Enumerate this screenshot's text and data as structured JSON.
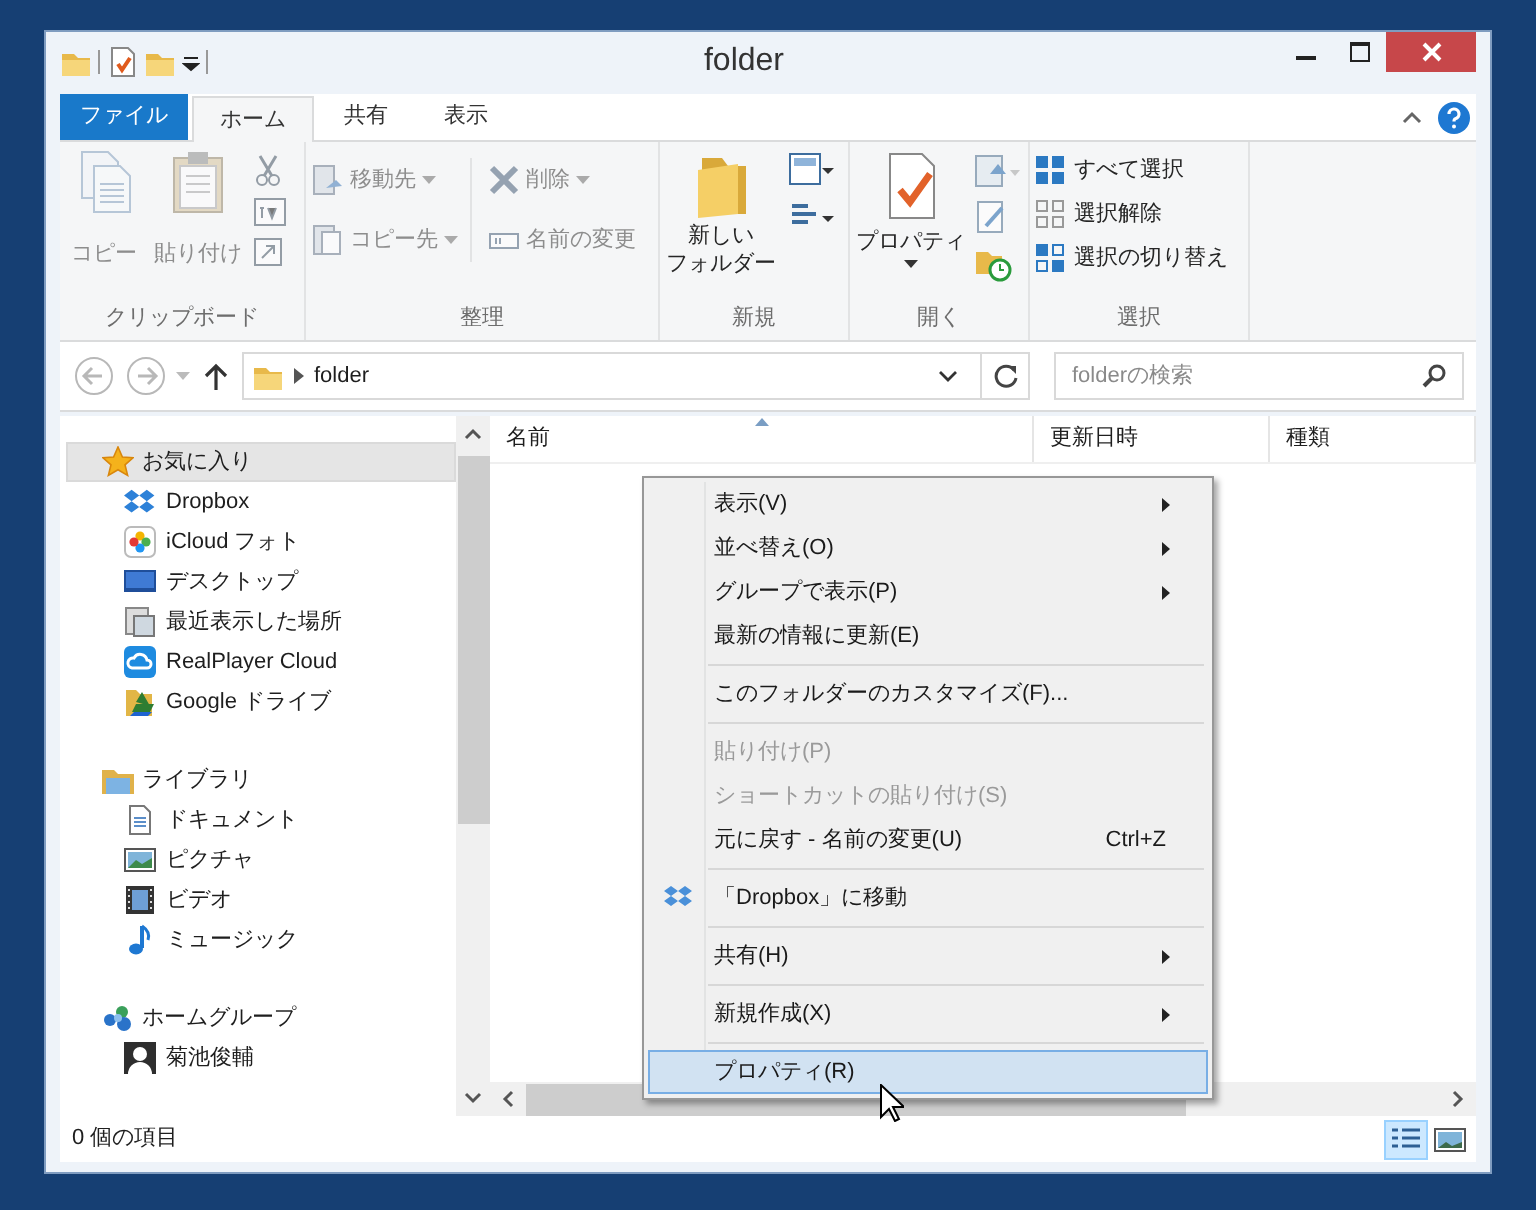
{
  "window": {
    "title": "folder"
  },
  "tabs": [
    {
      "label": "ファイル",
      "kind": "file",
      "selected": false
    },
    {
      "label": "ホーム",
      "kind": "tab",
      "selected": true
    },
    {
      "label": "共有",
      "kind": "tab",
      "selected": false
    },
    {
      "label": "表示",
      "kind": "tab",
      "selected": false
    }
  ],
  "ribbon": {
    "groups": [
      {
        "label": "クリップボード",
        "buttons": [
          {
            "label": "コピー",
            "disabled": true
          },
          {
            "label": "貼り付け",
            "disabled": true
          }
        ]
      },
      {
        "label": "整理",
        "buttons": [
          {
            "label": "移動先",
            "disabled": true,
            "dropdown": true
          },
          {
            "label": "コピー先",
            "disabled": true,
            "dropdown": true
          },
          {
            "label": "削除",
            "disabled": true,
            "dropdown": true
          },
          {
            "label": "名前の変更",
            "disabled": true,
            "dropdown": false
          }
        ]
      },
      {
        "label": "新規",
        "buttons": [
          {
            "label_lines": [
              "新しい",
              "フォルダー"
            ],
            "disabled": false
          }
        ]
      },
      {
        "label": "開く",
        "buttons": [
          {
            "label": "プロパティ",
            "disabled": false,
            "dropdown": true
          }
        ]
      },
      {
        "label": "選択",
        "buttons": [
          {
            "label": "すべて選択",
            "disabled": false
          },
          {
            "label": "選択解除",
            "disabled": false
          },
          {
            "label": "選択の切り替え",
            "disabled": false
          }
        ]
      }
    ]
  },
  "address": {
    "path": "folder",
    "search_placeholder": "folderの検索"
  },
  "navigation": [
    {
      "label": "お気に入り",
      "selected": true,
      "children": [
        {
          "label": "Dropbox"
        },
        {
          "label": "iCloud フォト"
        },
        {
          "label": "デスクトップ"
        },
        {
          "label": "最近表示した場所"
        },
        {
          "label": "RealPlayer Cloud"
        },
        {
          "label": "Google ドライブ"
        }
      ]
    },
    {
      "label": "ライブラリ",
      "selected": false,
      "children": [
        {
          "label": "ドキュメント"
        },
        {
          "label": "ピクチャ"
        },
        {
          "label": "ビデオ"
        },
        {
          "label": "ミュージック"
        }
      ]
    },
    {
      "label": "ホームグループ",
      "selected": false,
      "children": [
        {
          "label": "菊池俊輔"
        }
      ]
    }
  ],
  "columns": [
    {
      "label": "名前",
      "sorted": true
    },
    {
      "label": "更新日時",
      "sorted": false
    },
    {
      "label": "種類",
      "sorted": false
    }
  ],
  "context_menu": [
    [
      {
        "label": "表示(V)",
        "submenu": true,
        "disabled": false,
        "selected": false
      },
      {
        "label": "並べ替え(O)",
        "submenu": true,
        "disabled": false,
        "selected": false
      },
      {
        "label": "グループで表示(P)",
        "submenu": true,
        "disabled": false,
        "selected": false
      },
      {
        "label": "最新の情報に更新(E)",
        "submenu": false,
        "disabled": false,
        "selected": false
      }
    ],
    [
      {
        "label": "このフォルダーのカスタマイズ(F)...",
        "submenu": false,
        "disabled": false,
        "selected": false
      }
    ],
    [
      {
        "label": "貼り付け(P)",
        "submenu": false,
        "disabled": true,
        "selected": false
      },
      {
        "label": "ショートカットの貼り付け(S)",
        "submenu": false,
        "disabled": true,
        "selected": false
      },
      {
        "label": "元に戻す - 名前の変更(U)",
        "shortcut": "Ctrl+Z",
        "submenu": false,
        "disabled": false,
        "selected": false
      }
    ],
    [
      {
        "label": "「Dropbox」に移動",
        "icon": true,
        "submenu": false,
        "disabled": false,
        "selected": false
      }
    ],
    [
      {
        "label": "共有(H)",
        "submenu": true,
        "disabled": false,
        "selected": false
      }
    ],
    [
      {
        "label": "新規作成(X)",
        "submenu": true,
        "disabled": false,
        "selected": false
      }
    ],
    [
      {
        "label": "プロパティ(R)",
        "submenu": false,
        "disabled": false,
        "selected": true
      }
    ]
  ],
  "status_bar": {
    "text": "0 個の項目",
    "views": [
      {
        "kind": "details",
        "selected": true
      },
      {
        "kind": "large_icons",
        "selected": false
      }
    ]
  }
}
